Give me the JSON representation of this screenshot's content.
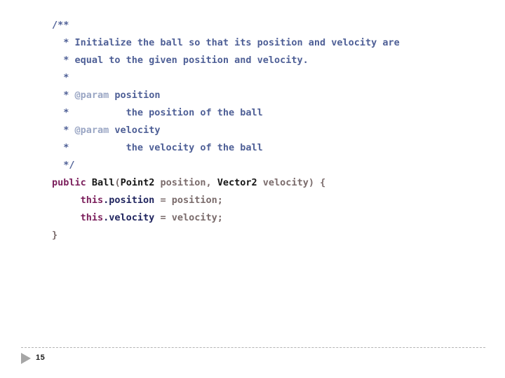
{
  "slide": {
    "background_color": "#ffffff",
    "page_number": "15",
    "footer": {
      "arrow_icon": "triangle-right-icon",
      "rule_style": "dashed",
      "rule_color": "#b4b4b4"
    }
  },
  "colors": {
    "comment": "#4e5f96",
    "javadoc_tag": "#9aa6c4",
    "keyword": "#7b1f5c",
    "type": "#151515",
    "identifier": "#7a6b6b",
    "field": "#20255f"
  },
  "code": {
    "language": "java",
    "full_text": "/**\n * Initialize the ball so that its position and velocity are\n * equal to the given position and velocity.\n *\n * @param position\n *           the position of the ball\n * @param velocity\n *           the velocity of the ball\n */\npublic Ball(Point2 position, Vector2 velocity) {\n    this.position = position;\n    this.velocity = velocity;\n}",
    "lines": [
      {
        "id": "line-1",
        "tokens": [
          {
            "t": "/**",
            "c": "tok-comment"
          }
        ]
      },
      {
        "id": "line-2",
        "tokens": [
          {
            "t": "  * Initialize the ball so that its position and velocity are",
            "c": "tok-comment"
          }
        ]
      },
      {
        "id": "line-3",
        "tokens": [
          {
            "t": "  * equal to the given position and velocity.",
            "c": "tok-comment"
          }
        ]
      },
      {
        "id": "line-4",
        "tokens": [
          {
            "t": "  *",
            "c": "tok-comment"
          }
        ]
      },
      {
        "id": "line-5",
        "tokens": [
          {
            "t": "  * ",
            "c": "tok-comment"
          },
          {
            "t": "@param",
            "c": "tok-tag"
          },
          {
            "t": " position",
            "c": "tok-comment"
          }
        ]
      },
      {
        "id": "line-6",
        "tokens": [
          {
            "t": "  *          the position of the ball",
            "c": "tok-comment"
          }
        ]
      },
      {
        "id": "line-7",
        "tokens": [
          {
            "t": "  * ",
            "c": "tok-comment"
          },
          {
            "t": "@param",
            "c": "tok-tag"
          },
          {
            "t": " velocity",
            "c": "tok-comment"
          }
        ]
      },
      {
        "id": "line-8",
        "tokens": [
          {
            "t": "  *          the velocity of the ball",
            "c": "tok-comment"
          }
        ]
      },
      {
        "id": "line-9",
        "tokens": [
          {
            "t": "  */",
            "c": "tok-comment"
          }
        ]
      },
      {
        "id": "line-10",
        "tokens": [
          {
            "t": "public",
            "c": "tok-keyword"
          },
          {
            "t": " ",
            "c": "tok-plain"
          },
          {
            "t": "Ball",
            "c": "tok-type"
          },
          {
            "t": "(",
            "c": "tok-plain"
          },
          {
            "t": "Point2",
            "c": "tok-type"
          },
          {
            "t": " position, ",
            "c": "tok-plain"
          },
          {
            "t": "Vector2",
            "c": "tok-type"
          },
          {
            "t": " velocity) {",
            "c": "tok-plain"
          }
        ]
      },
      {
        "id": "line-11",
        "tokens": [
          {
            "t": "     ",
            "c": "tok-plain"
          },
          {
            "t": "this",
            "c": "tok-keyword"
          },
          {
            "t": ".position",
            "c": "tok-field"
          },
          {
            "t": " = position;",
            "c": "tok-plain"
          }
        ]
      },
      {
        "id": "line-12",
        "tokens": [
          {
            "t": "     ",
            "c": "tok-plain"
          },
          {
            "t": "this",
            "c": "tok-keyword"
          },
          {
            "t": ".velocity",
            "c": "tok-field"
          },
          {
            "t": " = velocity;",
            "c": "tok-plain"
          }
        ]
      },
      {
        "id": "line-13",
        "tokens": [
          {
            "t": "}",
            "c": "tok-plain"
          }
        ]
      }
    ]
  }
}
